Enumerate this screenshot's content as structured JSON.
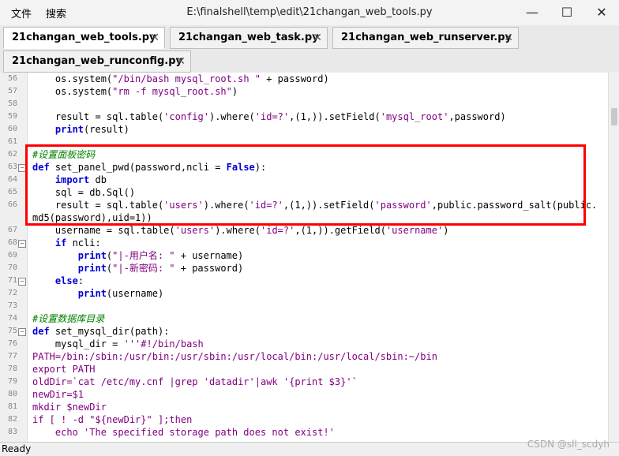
{
  "window": {
    "title": "E:\\finalshell\\temp\\edit\\21changan_web_tools.py",
    "menu": [
      "文件",
      "搜索"
    ],
    "controls": {
      "minimize": "—",
      "maximize": "☐",
      "close": "✕"
    }
  },
  "tabs": [
    {
      "label": "21changan_web_tools.py",
      "close": "✕"
    },
    {
      "label": "21changan_web_task.py",
      "close": "✕"
    },
    {
      "label": "21changan_web_runserver.py",
      "close": "✕"
    },
    {
      "label": "21changan_web_runconfig.py",
      "close": "✕"
    }
  ],
  "lines": [
    {
      "n": "56",
      "fold": false,
      "html": "    os.system(<span class=\"str\">\"/bin/bash mysql_root.sh \"</span> + password)"
    },
    {
      "n": "57",
      "fold": false,
      "html": "    os.system(<span class=\"str\">\"rm -f mysql_root.sh\"</span>)"
    },
    {
      "n": "58",
      "fold": false,
      "html": ""
    },
    {
      "n": "59",
      "fold": false,
      "html": "    result = sql.table(<span class=\"str\">'config'</span>).where(<span class=\"str\">'id=?'</span>,(1,)).setField(<span class=\"str\">'mysql_root'</span>,password)"
    },
    {
      "n": "60",
      "fold": false,
      "html": "    <span class=\"kw\">print</span>(result)"
    },
    {
      "n": "61",
      "fold": false,
      "html": ""
    },
    {
      "n": "62",
      "fold": false,
      "html": "<span class=\"cmt\">#设置面板密码</span>"
    },
    {
      "n": "63",
      "fold": true,
      "html": "<span class=\"kw\">def</span> set_panel_pwd(password,ncli = <span class=\"kw\">False</span>):"
    },
    {
      "n": "64",
      "fold": false,
      "html": "    <span class=\"kw\">import</span> db"
    },
    {
      "n": "65",
      "fold": false,
      "html": "    sql = db.Sql()"
    },
    {
      "n": "66",
      "fold": false,
      "html": "    result = sql.table(<span class=\"str\">'users'</span>).where(<span class=\"str\">'id=?'</span>,(1,)).setField(<span class=\"str\">'password'</span>,public.password_salt(public."
    },
    {
      "n": "",
      "fold": false,
      "html": "md5(password),uid=1))"
    },
    {
      "n": "67",
      "fold": false,
      "html": "    username = sql.table(<span class=\"str\">'users'</span>).where(<span class=\"str\">'id=?'</span>,(1,)).getField(<span class=\"str\">'username'</span>)"
    },
    {
      "n": "68",
      "fold": true,
      "html": "    <span class=\"kw\">if</span> ncli:"
    },
    {
      "n": "69",
      "fold": false,
      "html": "        <span class=\"kw\">print</span>(<span class=\"str\">\"|-用户名: \"</span> + username)"
    },
    {
      "n": "70",
      "fold": false,
      "html": "        <span class=\"kw\">print</span>(<span class=\"str\">\"|-新密码: \"</span> + password)"
    },
    {
      "n": "71",
      "fold": true,
      "html": "    <span class=\"kw\">else</span>:"
    },
    {
      "n": "72",
      "fold": false,
      "html": "        <span class=\"kw\">print</span>(username)"
    },
    {
      "n": "73",
      "fold": false,
      "html": ""
    },
    {
      "n": "74",
      "fold": false,
      "html": "<span class=\"cmt\">#设置数据库目录</span>"
    },
    {
      "n": "75",
      "fold": true,
      "html": "<span class=\"kw\">def</span> set_mysql_dir(path):"
    },
    {
      "n": "76",
      "fold": false,
      "html": "    mysql_dir = <span class=\"str\">'''#!/bin/bash</span>"
    },
    {
      "n": "77",
      "fold": false,
      "html": "<span class=\"str\">PATH=/bin:/sbin:/usr/bin:/usr/sbin:/usr/local/bin:/usr/local/sbin:~/bin</span>"
    },
    {
      "n": "78",
      "fold": false,
      "html": "<span class=\"str\">export PATH</span>"
    },
    {
      "n": "79",
      "fold": false,
      "html": "<span class=\"str\">oldDir=`cat /etc/my.cnf |grep 'datadir'|awk '{print $3}'`</span>"
    },
    {
      "n": "80",
      "fold": false,
      "html": "<span class=\"str\">newDir=$1</span>"
    },
    {
      "n": "81",
      "fold": false,
      "html": "<span class=\"str\">mkdir $newDir</span>"
    },
    {
      "n": "82",
      "fold": false,
      "html": "<span class=\"str\">if [ ! -d \"${newDir}\" ];then</span>"
    },
    {
      "n": "83",
      "fold": false,
      "html": "<span class=\"str\">    echo 'The specified storage path does not exist!'</span>"
    }
  ],
  "status": {
    "text": "Ready"
  },
  "watermark": "CSDN @sll_scdyh",
  "colors": {
    "keyword": "#0000d6",
    "string": "#800080",
    "comment": "#008000",
    "highlight_box": "#ff0000"
  }
}
